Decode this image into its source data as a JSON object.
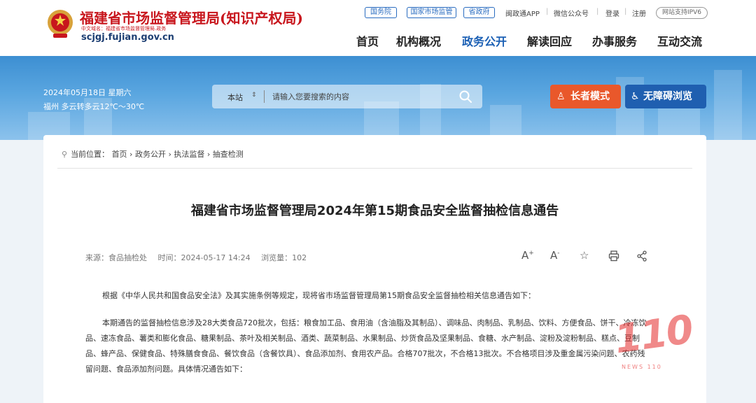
{
  "header": {
    "site_title": "福建省市场监督管理局(知识产权局)",
    "cn_domain": "中文域名：福建省市场监督管理局.政务",
    "domain": "scjgj.fujian.gov.cn"
  },
  "top_links": {
    "pills": [
      "国务院",
      "国家市场监管",
      "省政府"
    ],
    "app": "闽政通APP",
    "wechat": "微信公众号",
    "login": "登录",
    "register": "注册",
    "ipv6": "网站支持IPV6"
  },
  "nav": [
    "首页",
    "机构概况",
    "政务公开",
    "解读回应",
    "办事服务",
    "互动交流"
  ],
  "nav_active": "政务公开",
  "banner": {
    "date": "2024年05月18日 星期六",
    "weather": "福州 多云转多云12℃～30℃",
    "search_scope": "本站",
    "search_placeholder": "请输入您要搜索的内容",
    "elder_mode": "长者模式",
    "accessibility": "无障碍浏览"
  },
  "breadcrumb": {
    "prefix": "当前位置：",
    "items": [
      "首页",
      "政务公开",
      "执法监督",
      "抽查检测"
    ]
  },
  "article": {
    "title": "福建省市场监督管理局2024年第15期食品安全监督抽检信息通告",
    "source": "来源：食品抽检处",
    "time": "时间：2024-05-17 14:24",
    "views": "浏览量：102",
    "tools": [
      "A+",
      "A-",
      "☆",
      "🖶",
      "share"
    ],
    "p1": "根据《中华人民共和国食品安全法》及其实施条例等规定，现将省市场监督管理局第15期食品安全监督抽检相关信息通告如下：",
    "p2": "本期通告的监督抽检信息涉及28大类食品720批次，包括：粮食加工品、食用油（含油脂及其制品）、调味品、肉制品、乳制品、饮料、方便食品、饼干、冷冻饮品、速冻食品、薯类和膨化食品、糖果制品、茶叶及相关制品、酒类、蔬菜制品、水果制品、炒货食品及坚果制品、食糖、水产制品、淀粉及淀粉制品、糕点、豆制品、蜂产品、保健食品、特殊膳食食品、餐饮食品（含餐饮具）、食品添加剂、食用农产品。合格707批次，不合格13批次。不合格项目涉及重金属污染问题、农药残留问题、食品添加剂问题。具体情况通告如下："
  },
  "watermark": {
    "mark": "110",
    "sub": "NEWS 110"
  },
  "colors": {
    "brand_red": "#c8161d",
    "nav_active": "#1a5fb4",
    "elder_orange": "#e9582b",
    "access_blue": "#1f5fb0"
  }
}
